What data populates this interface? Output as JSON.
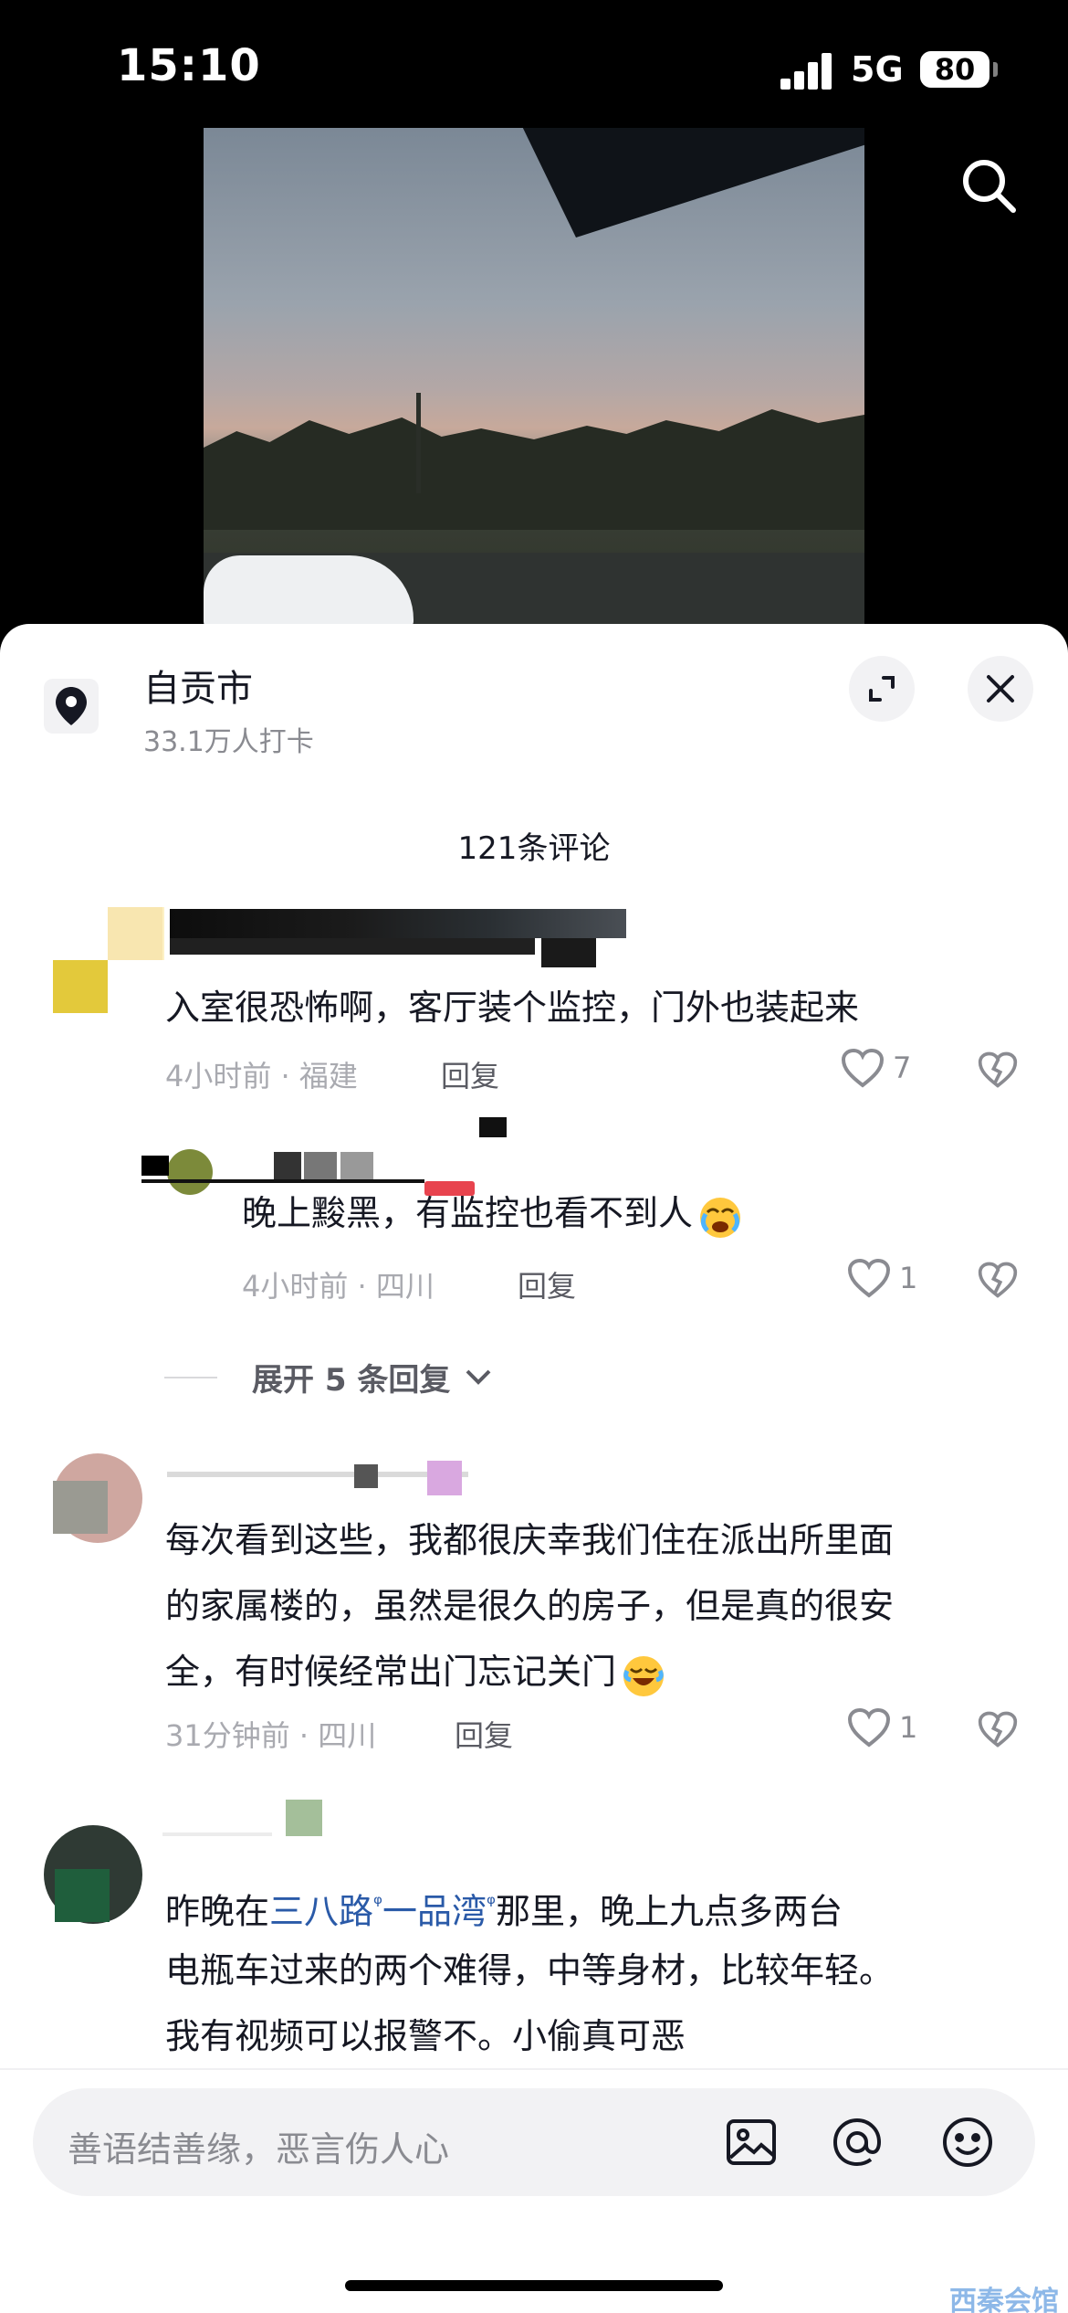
{
  "status_bar": {
    "time": "15:10",
    "network": "5G",
    "battery": "80"
  },
  "location": {
    "title": "自贡市",
    "subtitle": "33.1万人打卡"
  },
  "comments_header": "121条评论",
  "comments": [
    {
      "text": "入室很恐怖啊，客厅装个监控，门外也装起来",
      "meta": "4小时前 · 福建",
      "reply_label": "回复",
      "likes": "7"
    },
    {
      "text": "晚上黢黑，有监控也看不到人",
      "meta": "4小时前 · 四川",
      "reply_label": "回复",
      "likes": "1"
    },
    {
      "text_lines": [
        "每次看到这些，我都很庆幸我们住在派出所里面",
        "的家属楼的，虽然是很久的房子，但是真的很安",
        "全，有时候经常出门忘记关门"
      ],
      "meta": "31分钟前 · 四川",
      "reply_label": "回复",
      "likes": "1"
    },
    {
      "line1_prefix": "昨晚在",
      "link1": "三八路",
      "link2": "一品湾",
      "line1_suffix": "那里，晚上九点多两台",
      "line2": "电瓶车过来的两个难得，中等身材，比较年轻。",
      "line3": "我有视频可以报警不。小偷真可恶"
    }
  ],
  "expand_replies": "展开 5 条回复",
  "input": {
    "placeholder": "善语结善缘，恶言伤人心"
  },
  "watermark": "西秦会馆",
  "icons": [
    "search-icon",
    "location-pin-icon",
    "expand-icon",
    "close-icon",
    "heart-icon",
    "broken-heart-icon",
    "chevron-down-icon",
    "image-icon",
    "at-icon",
    "emoji-icon"
  ],
  "colors": {
    "link": "#2a5aa8",
    "sheet_bg": "#ffffff",
    "text": "#161823",
    "meta": "#a9aab0"
  }
}
